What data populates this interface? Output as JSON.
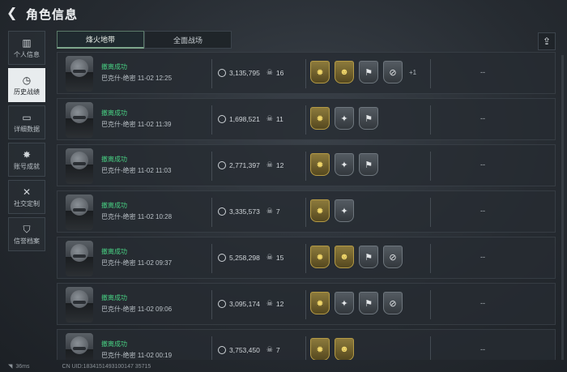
{
  "header": {
    "title": "角色信息"
  },
  "sidebar": {
    "items": [
      {
        "label": "个人信息",
        "icon": "bar-chart-icon",
        "glyph": "▥",
        "active": false
      },
      {
        "label": "历史战绩",
        "icon": "clock-icon",
        "glyph": "◷",
        "active": true
      },
      {
        "label": "详细数据",
        "icon": "folder-icon",
        "glyph": "▭",
        "active": false
      },
      {
        "label": "账号成就",
        "icon": "medal-icon",
        "glyph": "✸",
        "active": false
      },
      {
        "label": "社交定制",
        "icon": "tools-icon",
        "glyph": "✕",
        "active": false
      },
      {
        "label": "信誉档案",
        "icon": "shield-icon",
        "glyph": "⛉",
        "active": false
      }
    ]
  },
  "tabs": [
    {
      "label": "烽火地带",
      "active": true
    },
    {
      "label": "全面战场",
      "active": false
    }
  ],
  "matches": [
    {
      "result": "撤离成功",
      "map": "巴克什-绝密",
      "time": "11-02 12:25",
      "value": "3,135,795",
      "kills": "16",
      "badges": [
        "gold",
        "gold",
        "gray",
        "gray"
      ],
      "extra": "+1",
      "note": "--"
    },
    {
      "result": "撤离成功",
      "map": "巴克什-绝密",
      "time": "11-02 11:39",
      "value": "1,698,521",
      "kills": "11",
      "badges": [
        "gold",
        "gray",
        "gray"
      ],
      "extra": "",
      "note": "--"
    },
    {
      "result": "撤离成功",
      "map": "巴克什-绝密",
      "time": "11-02 11:03",
      "value": "2,771,397",
      "kills": "12",
      "badges": [
        "gold",
        "gray",
        "gray"
      ],
      "extra": "",
      "note": "--"
    },
    {
      "result": "撤离成功",
      "map": "巴克什-绝密",
      "time": "11-02 10:28",
      "value": "3,335,573",
      "kills": "7",
      "badges": [
        "gold",
        "gray"
      ],
      "extra": "",
      "note": "--"
    },
    {
      "result": "撤离成功",
      "map": "巴克什-绝密",
      "time": "11-02 09:37",
      "value": "5,258,298",
      "kills": "15",
      "badges": [
        "gold",
        "gold",
        "gray",
        "gray"
      ],
      "extra": "",
      "note": "--"
    },
    {
      "result": "撤离成功",
      "map": "巴克什-绝密",
      "time": "11-02 09:06",
      "value": "3,095,174",
      "kills": "12",
      "badges": [
        "gold",
        "gray",
        "gray",
        "gray"
      ],
      "extra": "",
      "note": "--"
    },
    {
      "result": "撤离成功",
      "map": "巴克什-绝密",
      "time": "11-02 00:19",
      "value": "3,753,450",
      "kills": "7",
      "badges": [
        "gold",
        "gold"
      ],
      "extra": "",
      "note": "--"
    }
  ],
  "footer": {
    "ping": "36ms",
    "uid": "CN UID:1834151493100147 35715"
  },
  "colors": {
    "success": "#48d083",
    "gold_badge": "#8c7a3c",
    "gray_badge": "#545b62"
  }
}
